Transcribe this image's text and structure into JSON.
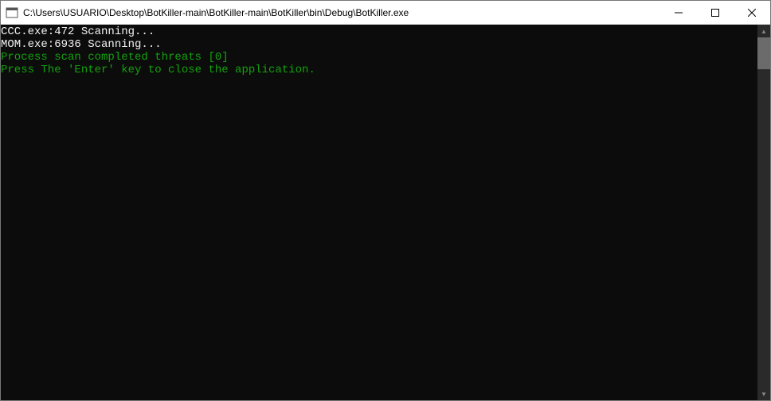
{
  "window": {
    "title": "C:\\Users\\USUARIO\\Desktop\\BotKiller-main\\BotKiller-main\\BotKiller\\bin\\Debug\\BotKiller.exe"
  },
  "console": {
    "lines": [
      {
        "text": "CCC.exe:472 Scanning...",
        "style": "white"
      },
      {
        "text": "MOM.exe:6936 Scanning...",
        "style": "white"
      },
      {
        "text": "Process scan completed threats [0]",
        "style": "green"
      },
      {
        "text": "Press The 'Enter' key to close the application.",
        "style": "green"
      }
    ]
  }
}
